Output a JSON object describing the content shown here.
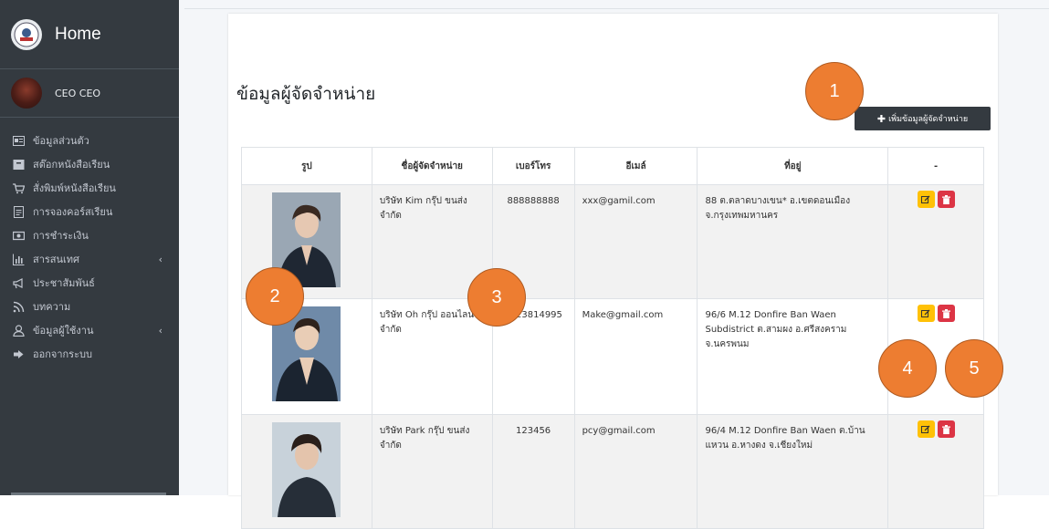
{
  "sidebar": {
    "brand_title": "Home",
    "user_name": "CEO CEO",
    "items": [
      {
        "label": "ข้อมูลส่วนตัว",
        "icon": "id-card-icon"
      },
      {
        "label": "สต๊อกหนังสือเรียน",
        "icon": "box-icon"
      },
      {
        "label": "สั่งพิมพ์หนังสือเรียน",
        "icon": "cart-icon"
      },
      {
        "label": "การจองคอร์สเรียน",
        "icon": "document-icon"
      },
      {
        "label": "การชำระเงิน",
        "icon": "money-icon"
      },
      {
        "label": "สารสนเทศ",
        "icon": "bar-chart-icon",
        "expandable": true
      },
      {
        "label": "ประชาสัมพันธ์",
        "icon": "megaphone-icon"
      },
      {
        "label": "บทความ",
        "icon": "rss-icon"
      },
      {
        "label": "ข้อมูลผู้ใช้งาน",
        "icon": "user-icon",
        "expandable": true
      },
      {
        "label": "ออกจากระบบ",
        "icon": "sign-out-icon"
      }
    ]
  },
  "main": {
    "title": "ข้อมูลผู้จัดจำหน่าย",
    "add_button_label": "เพิ่มข้อมูลผู้จัดจำหน่าย",
    "table": {
      "columns": [
        "รูป",
        "ชื่อผู้จัดจำหน่าย",
        "เบอร์โทร",
        "อีเมล์",
        "ที่อยู่",
        "-"
      ],
      "rows": [
        {
          "name": "บริษัท Kim กรุ๊ป ขนส่ง จำกัด",
          "phone": "888888888",
          "email": "xxx@gamil.com",
          "address": "88 ต.ตลาดบางเขน* อ.เขตดอนเมือง จ.กรุงเทพมหานคร"
        },
        {
          "name": "บริษัท Oh กรุ๊ป ออนไลน์ จำกัด",
          "phone": "0623814995",
          "email": "Make@gmail.com",
          "address": "96/6 M.12 Donfire Ban Waen Subdistrict ต.สามผง อ.ศรีสงคราม จ.นครพนม"
        },
        {
          "name": "บริษัท Park กรุ๊ป ขนส่ง จำกัด",
          "phone": "123456",
          "email": "pcy@gmail.com",
          "address": "96/4 M.12 Donfire Ban Waen ต.บ้านแหวน อ.หางดง จ.เชียงใหม่"
        }
      ]
    }
  },
  "callouts": [
    "1",
    "2",
    "3",
    "4",
    "5"
  ],
  "colors": {
    "sidebar_bg": "#343a40",
    "edit_button": "#ffc107",
    "delete_button": "#dc3545",
    "callout": "#ed7d31"
  }
}
